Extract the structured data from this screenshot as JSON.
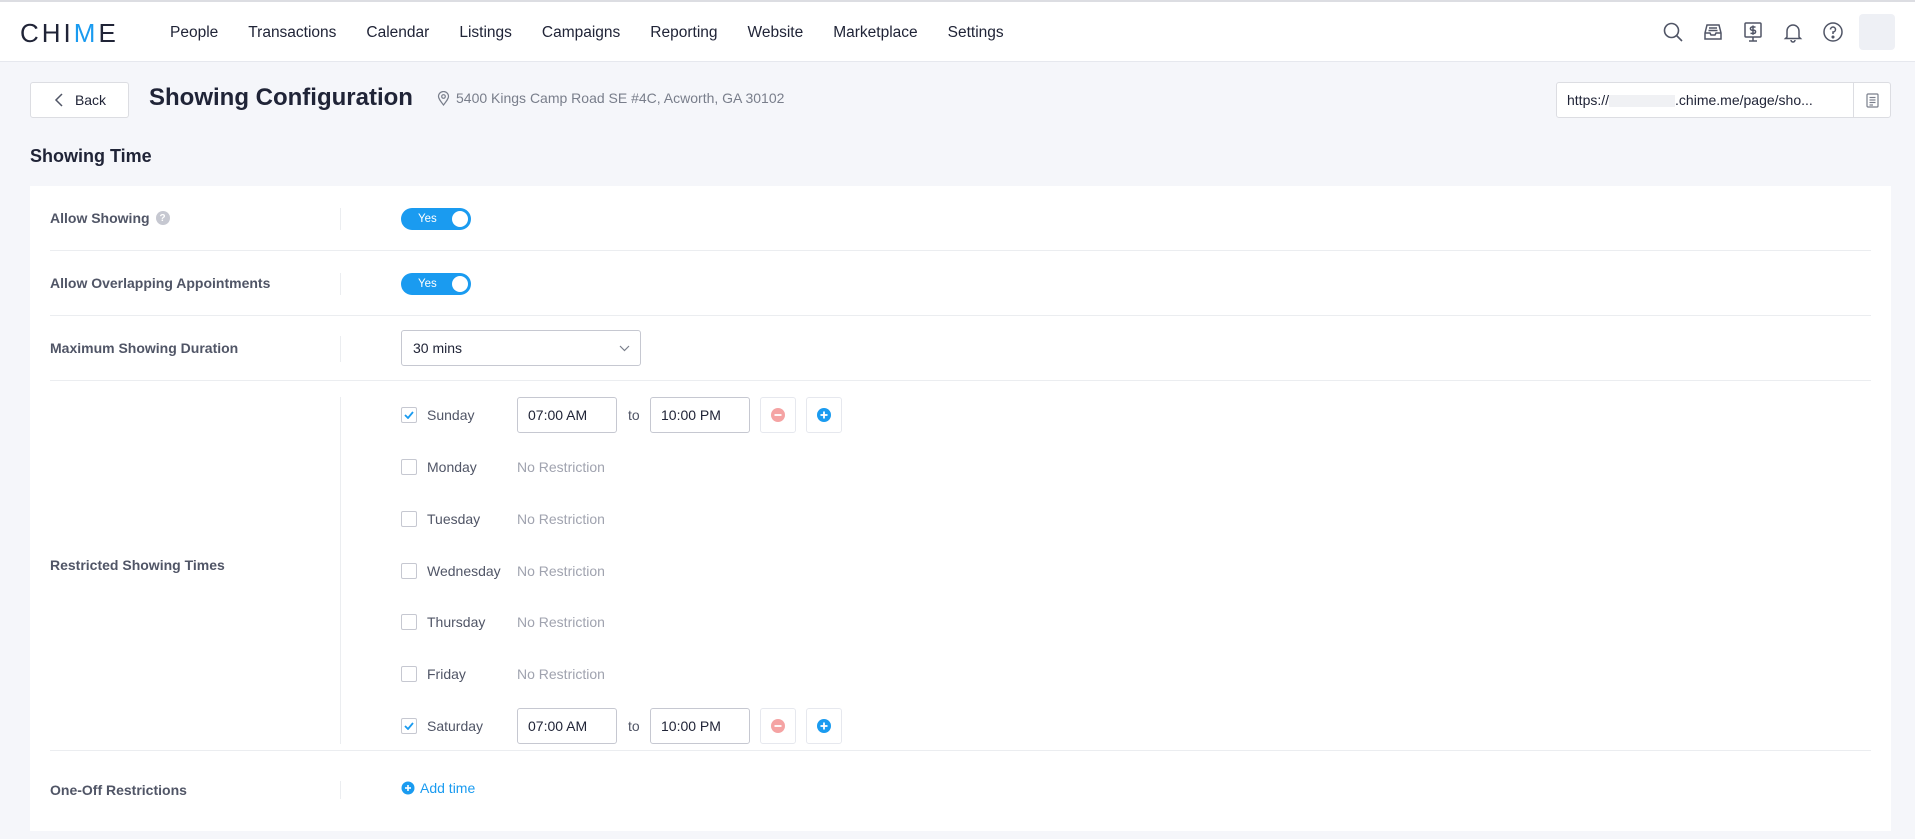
{
  "app": {
    "logo_left": "CHI",
    "logo_mid": "M",
    "logo_right": "E"
  },
  "nav": {
    "items": [
      {
        "label": "People"
      },
      {
        "label": "Transactions"
      },
      {
        "label": "Calendar"
      },
      {
        "label": "Listings"
      },
      {
        "label": "Campaigns"
      },
      {
        "label": "Reporting"
      },
      {
        "label": "Website"
      },
      {
        "label": "Marketplace"
      },
      {
        "label": "Settings"
      }
    ],
    "icons": [
      "search-icon",
      "inbox-icon",
      "dollar-monitor-icon",
      "bell-icon",
      "help-icon"
    ]
  },
  "header": {
    "back_label": "Back",
    "title": "Showing Configuration",
    "address": "5400 Kings Camp Road SE #4C, Acworth, GA 30102",
    "url_prefix": "https://",
    "url_suffix": ".chime.me/page/sho..."
  },
  "section": {
    "title": "Showing Time"
  },
  "settings": {
    "allow_showing": {
      "label": "Allow Showing",
      "help": "?",
      "value": "Yes",
      "enabled": true
    },
    "allow_overlap": {
      "label": "Allow Overlapping Appointments",
      "value": "Yes",
      "enabled": true
    },
    "max_duration": {
      "label": "Maximum Showing Duration",
      "value": "30 mins"
    },
    "restricted": {
      "label": "Restricted Showing Times",
      "to_label": "to",
      "no_restriction": "No Restriction",
      "days": [
        {
          "name": "Sunday",
          "checked": true,
          "start": "07:00 AM",
          "end": "10:00 PM"
        },
        {
          "name": "Monday",
          "checked": false
        },
        {
          "name": "Tuesday",
          "checked": false
        },
        {
          "name": "Wednesday",
          "checked": false
        },
        {
          "name": "Thursday",
          "checked": false
        },
        {
          "name": "Friday",
          "checked": false
        },
        {
          "name": "Saturday",
          "checked": true,
          "start": "07:00 AM",
          "end": "10:00 PM"
        }
      ]
    },
    "one_off": {
      "label": "One-Off Restrictions",
      "add_label": "Add time"
    }
  },
  "colors": {
    "accent": "#1a9bf0",
    "remove": "#f5a3a3"
  }
}
